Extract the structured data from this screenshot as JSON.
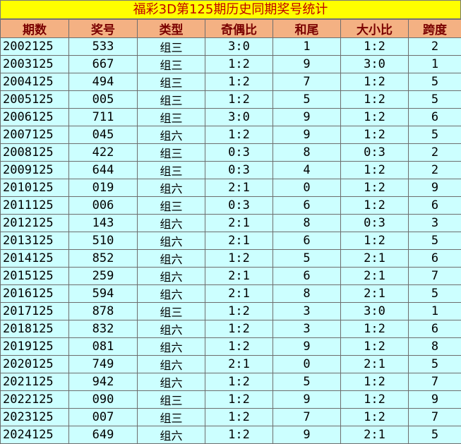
{
  "title": "福彩3D第125期历史同期奖号统计",
  "columns": [
    "期数",
    "奖号",
    "类型",
    "奇偶比",
    "和尾",
    "大小比",
    "跨度"
  ],
  "rows": [
    [
      "2002125",
      "533",
      "组三",
      "3:0",
      "1",
      "1:2",
      "2"
    ],
    [
      "2003125",
      "667",
      "组三",
      "1:2",
      "9",
      "3:0",
      "1"
    ],
    [
      "2004125",
      "494",
      "组三",
      "1:2",
      "7",
      "1:2",
      "5"
    ],
    [
      "2005125",
      "005",
      "组三",
      "1:2",
      "5",
      "1:2",
      "5"
    ],
    [
      "2006125",
      "711",
      "组三",
      "3:0",
      "9",
      "1:2",
      "6"
    ],
    [
      "2007125",
      "045",
      "组六",
      "1:2",
      "9",
      "1:2",
      "5"
    ],
    [
      "2008125",
      "422",
      "组三",
      "0:3",
      "8",
      "0:3",
      "2"
    ],
    [
      "2009125",
      "644",
      "组三",
      "0:3",
      "4",
      "1:2",
      "2"
    ],
    [
      "2010125",
      "019",
      "组六",
      "2:1",
      "0",
      "1:2",
      "9"
    ],
    [
      "2011125",
      "006",
      "组三",
      "0:3",
      "6",
      "1:2",
      "6"
    ],
    [
      "2012125",
      "143",
      "组六",
      "2:1",
      "8",
      "0:3",
      "3"
    ],
    [
      "2013125",
      "510",
      "组六",
      "2:1",
      "6",
      "1:2",
      "5"
    ],
    [
      "2014125",
      "852",
      "组六",
      "1:2",
      "5",
      "2:1",
      "6"
    ],
    [
      "2015125",
      "259",
      "组六",
      "2:1",
      "6",
      "2:1",
      "7"
    ],
    [
      "2016125",
      "594",
      "组六",
      "2:1",
      "8",
      "2:1",
      "5"
    ],
    [
      "2017125",
      "878",
      "组三",
      "1:2",
      "3",
      "3:0",
      "1"
    ],
    [
      "2018125",
      "832",
      "组六",
      "1:2",
      "3",
      "1:2",
      "6"
    ],
    [
      "2019125",
      "081",
      "组六",
      "1:2",
      "9",
      "1:2",
      "8"
    ],
    [
      "2020125",
      "749",
      "组六",
      "2:1",
      "0",
      "2:1",
      "5"
    ],
    [
      "2021125",
      "942",
      "组六",
      "1:2",
      "5",
      "1:2",
      "7"
    ],
    [
      "2022125",
      "090",
      "组三",
      "1:2",
      "9",
      "1:2",
      "9"
    ],
    [
      "2023125",
      "007",
      "组三",
      "1:2",
      "7",
      "1:2",
      "7"
    ],
    [
      "2024125",
      "649",
      "组六",
      "1:2",
      "9",
      "2:1",
      "5"
    ]
  ]
}
